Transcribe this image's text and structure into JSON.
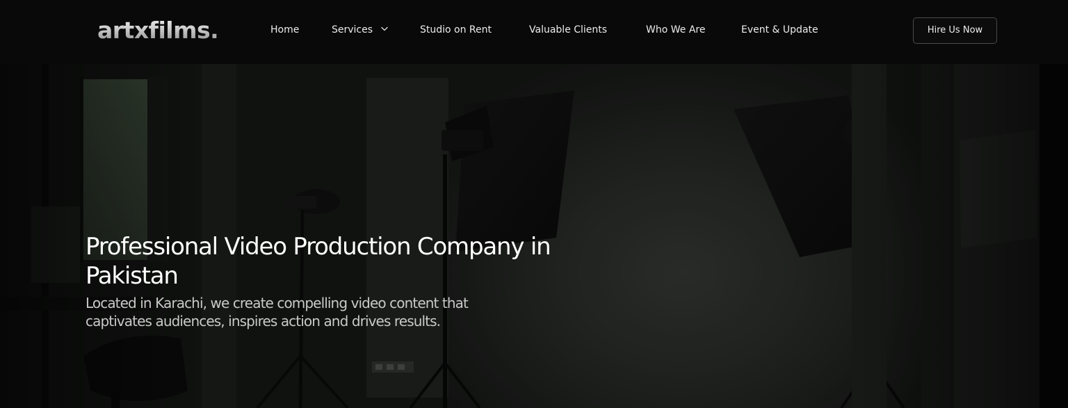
{
  "brand": {
    "logo_text": "artxfilms."
  },
  "nav": {
    "items": [
      {
        "label": "Home"
      },
      {
        "label": "Services",
        "has_dropdown": true,
        "icon": "chevron-down-icon"
      },
      {
        "label": "Studio on Rent"
      },
      {
        "label": "Valuable Clients"
      },
      {
        "label": "Who We Are"
      },
      {
        "label": "Event & Update"
      }
    ],
    "cta_label": "Hire Us Now"
  },
  "hero": {
    "title": "Professional Video Production Company in Pakistan",
    "subtitle": "Located in Karachi, we create compelling video content that captivates audiences, inspires action and drives results."
  },
  "colors": {
    "nav_background": "#090909",
    "hero_background": "#1a1c1a",
    "text_primary": "#ffffff",
    "text_secondary": "#c9c9c9",
    "button_border": "#4a4a4a"
  }
}
